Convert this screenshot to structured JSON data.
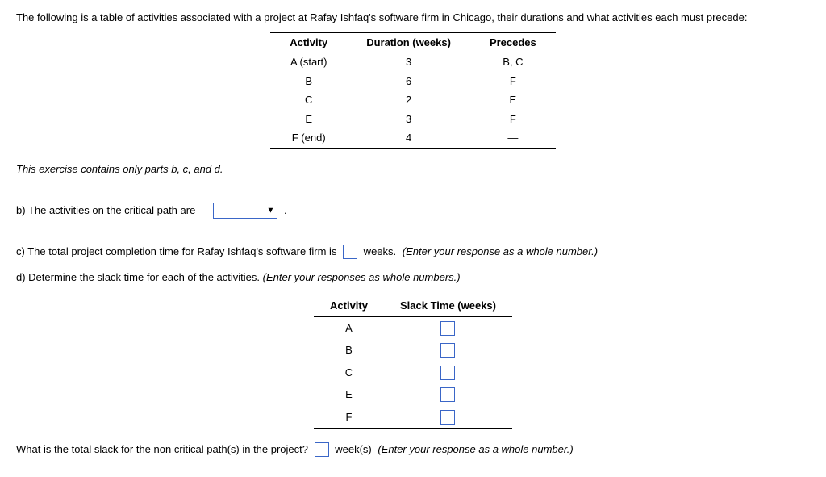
{
  "intro": "The following is a table of activities associated with a project at Rafay Ishfaq's software firm in Chicago, their durations and what activities each must precede:",
  "table1": {
    "headers": [
      "Activity",
      "Duration (weeks)",
      "Precedes"
    ],
    "rows": [
      [
        "A (start)",
        "3",
        "B, C"
      ],
      [
        "B",
        "6",
        "F"
      ],
      [
        "C",
        "2",
        "E"
      ],
      [
        "E",
        "3",
        "F"
      ],
      [
        "F (end)",
        "4",
        "—"
      ]
    ]
  },
  "note": "This exercise contains only parts b, c, and d.",
  "partB": {
    "pre": "b) The activities on the critical path are ",
    "post": " ."
  },
  "partC": {
    "pre": "c) The total project completion time for Rafay Ishfaq's software firm is ",
    "post1": " weeks. ",
    "post2": "(Enter your response as a whole number.)"
  },
  "partD": {
    "pre": "d) Determine the slack time for each of the activities. ",
    "post": "(Enter your responses as whole numbers.)"
  },
  "table2": {
    "headers": [
      "Activity",
      "Slack Time (weeks)"
    ],
    "rows": [
      "A",
      "B",
      "C",
      "E",
      "F"
    ]
  },
  "final": {
    "pre": "What is the total slack for the non critical path(s) in the project? ",
    "post1": " week(s) ",
    "post2": "(Enter your response as a whole number.)"
  }
}
